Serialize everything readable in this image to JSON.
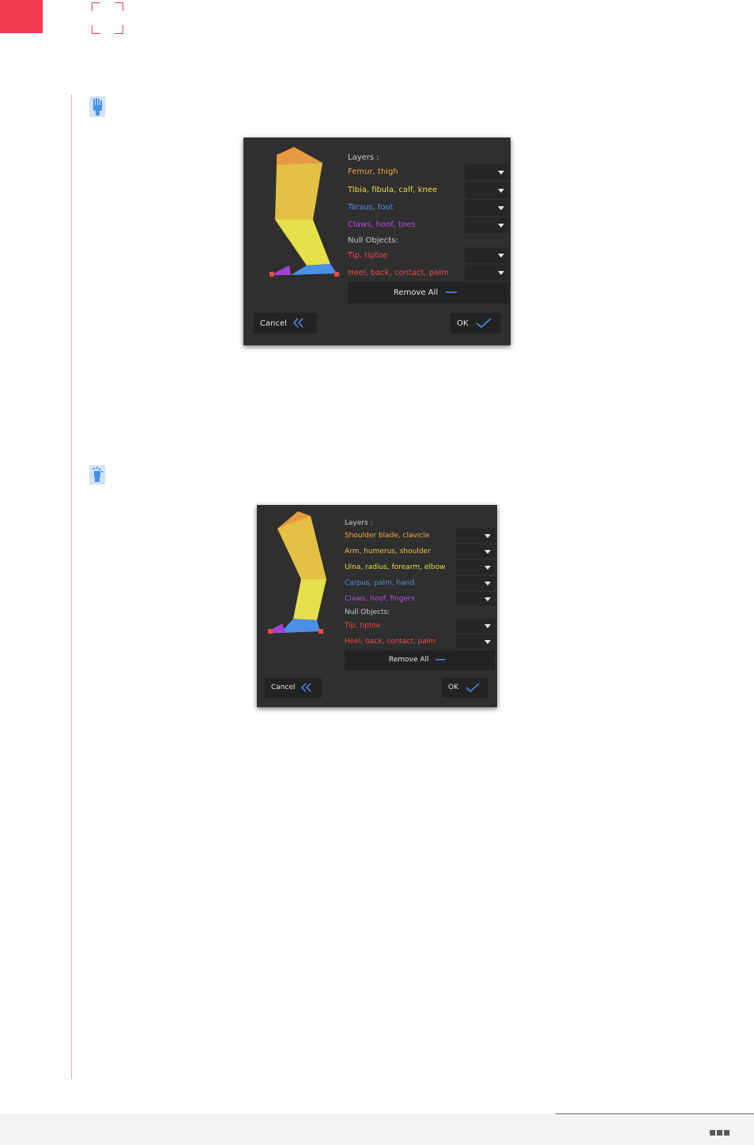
{
  "dialog_rear": {
    "layers_heading": "Layers :",
    "layers": [
      {
        "label": "Femur, thigh",
        "color": "#f2a53c"
      },
      {
        "label": "Tibia, fibula, calf, knee",
        "color": "#ecd94a"
      },
      {
        "label": "Tarsus, foot",
        "color": "#4a8fe8"
      },
      {
        "label": "Claws, hoof, toes",
        "color": "#b44ee0"
      }
    ],
    "null_heading": "Null Objects:",
    "nulls": [
      {
        "label": "Tip, tiptoe",
        "color": "#f04848"
      },
      {
        "label": "Heel, back, contact, palm",
        "color": "#f04848"
      }
    ],
    "remove_all": "Remove All",
    "cancel": "Cancel",
    "ok": "OK"
  },
  "dialog_front": {
    "layers_heading": "Layers :",
    "layers": [
      {
        "label": "Shoulder blade, clavicle",
        "color": "#f2a53c"
      },
      {
        "label": "Arm, humerus, shoulder",
        "color": "#f2c24a"
      },
      {
        "label": "Ulna, radius, forearm, elbow",
        "color": "#ecd94a"
      },
      {
        "label": "Carpus, palm, hand",
        "color": "#4a8fe8"
      },
      {
        "label": "Claws, hoof, fingers",
        "color": "#b44ee0"
      }
    ],
    "null_heading": "Null Objects:",
    "nulls": [
      {
        "label": "Tip, tiptoe",
        "color": "#f04848"
      },
      {
        "label": "Heel, back, contact, palm",
        "color": "#f04848"
      }
    ],
    "remove_all": "Remove All",
    "cancel": "Cancel",
    "ok": "OK"
  },
  "colors": {
    "accent": "#f23a52",
    "blue": "#4a8fe8",
    "dialog_bg": "#2f2f2f"
  }
}
